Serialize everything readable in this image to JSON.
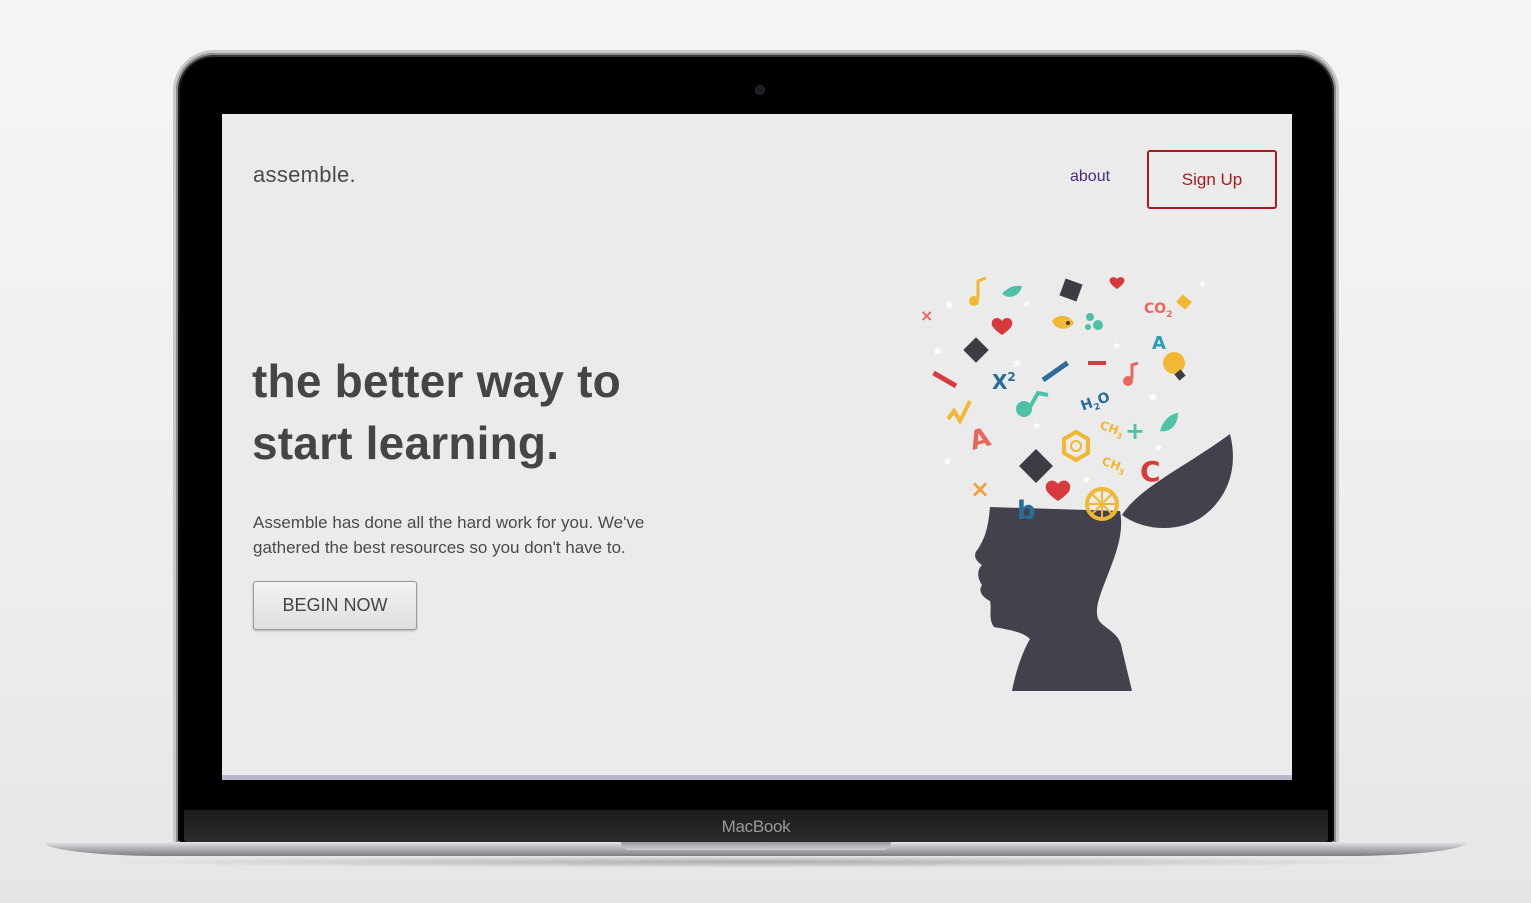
{
  "device": {
    "brand_label": "MacBook"
  },
  "site": {
    "logo": "assemble.",
    "nav": {
      "about_label": "about",
      "signup_label": "Sign Up"
    },
    "hero": {
      "headline_line1": "the better way to",
      "headline_line2": "start learning.",
      "description_line1": "Assemble has done all the hard work for you. We've",
      "description_line2": "gathered the best resources so you don't have to.",
      "cta_label": "BEGIN NOW"
    },
    "illustration": {
      "symbols": [
        "CO",
        "2",
        "A",
        "X",
        "2",
        "H",
        "2",
        "O",
        "CH",
        "3",
        "CH",
        "3",
        "A",
        "C",
        "b"
      ]
    }
  },
  "colors": {
    "accent_red": "#a61c22",
    "link_purple": "#4b2a83",
    "head_silhouette": "#43414b",
    "screen_bg": "#ebebeb"
  }
}
